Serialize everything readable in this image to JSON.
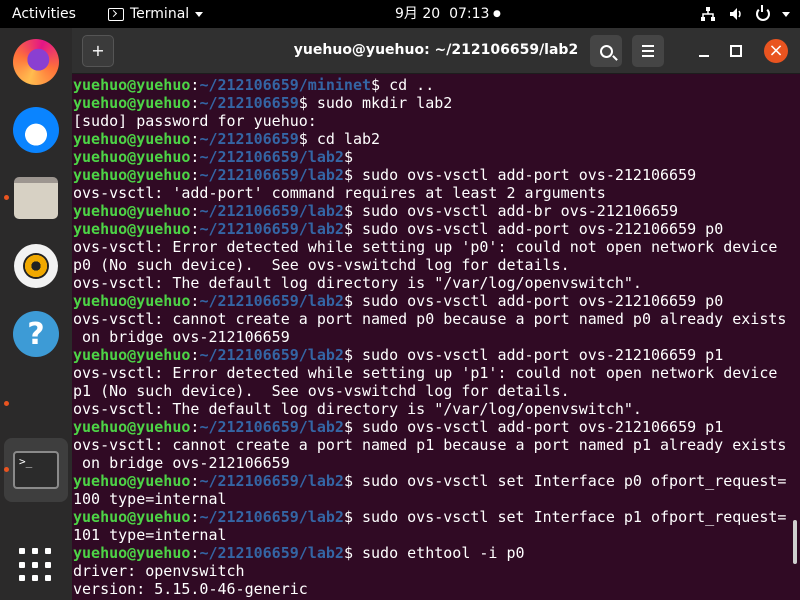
{
  "topbar": {
    "activities": "Activities",
    "app_name": "Terminal",
    "date": "9月 20",
    "time": "07:13",
    "dot": "●"
  },
  "dock": {
    "items": [
      {
        "name": "firefox-icon",
        "label": "Firefox"
      },
      {
        "name": "thunderbird-icon",
        "label": "Thunderbird"
      },
      {
        "name": "files-icon",
        "label": "Files"
      },
      {
        "name": "rhythmbox-icon",
        "label": "Rhythmbox"
      },
      {
        "name": "help-icon",
        "label": "Help",
        "glyph": "?"
      },
      {
        "name": "terminal-icon",
        "label": "Terminal",
        "glyph": ">_"
      },
      {
        "name": "show-applications-icon",
        "label": "Show Applications"
      }
    ]
  },
  "window": {
    "title": "yuehuo@yuehuo: ~/212106659/lab2"
  },
  "terminal": {
    "lines": [
      {
        "user": "yuehuo@yuehuo",
        "path": "~/212106659/mininet",
        "cmd": " cd .."
      },
      {
        "user": "yuehuo@yuehuo",
        "path": "~/212106659",
        "cmd": " sudo mkdir lab2"
      },
      {
        "text": "[sudo] password for yuehuo:"
      },
      {
        "user": "yuehuo@yuehuo",
        "path": "~/212106659",
        "cmd": " cd lab2"
      },
      {
        "user": "yuehuo@yuehuo",
        "path": "~/212106659/lab2",
        "cmd": ""
      },
      {
        "user": "yuehuo@yuehuo",
        "path": "~/212106659/lab2",
        "cmd": " sudo ovs-vsctl add-port ovs-212106659"
      },
      {
        "text": "ovs-vsctl: 'add-port' command requires at least 2 arguments"
      },
      {
        "user": "yuehuo@yuehuo",
        "path": "~/212106659/lab2",
        "cmd": " sudo ovs-vsctl add-br ovs-212106659"
      },
      {
        "user": "yuehuo@yuehuo",
        "path": "~/212106659/lab2",
        "cmd": " sudo ovs-vsctl add-port ovs-212106659 p0"
      },
      {
        "text": "ovs-vsctl: Error detected while setting up 'p0': could not open network device"
      },
      {
        "text": "p0 (No such device).  See ovs-vswitchd log for details."
      },
      {
        "text": "ovs-vsctl: The default log directory is \"/var/log/openvswitch\"."
      },
      {
        "user": "yuehuo@yuehuo",
        "path": "~/212106659/lab2",
        "cmd": " sudo ovs-vsctl add-port ovs-212106659 p0"
      },
      {
        "text": "ovs-vsctl: cannot create a port named p0 because a port named p0 already exists"
      },
      {
        "text": " on bridge ovs-212106659"
      },
      {
        "user": "yuehuo@yuehuo",
        "path": "~/212106659/lab2",
        "cmd": " sudo ovs-vsctl add-port ovs-212106659 p1"
      },
      {
        "text": "ovs-vsctl: Error detected while setting up 'p1': could not open network device"
      },
      {
        "text": "p1 (No such device).  See ovs-vswitchd log for details."
      },
      {
        "text": "ovs-vsctl: The default log directory is \"/var/log/openvswitch\"."
      },
      {
        "user": "yuehuo@yuehuo",
        "path": "~/212106659/lab2",
        "cmd": " sudo ovs-vsctl add-port ovs-212106659 p1"
      },
      {
        "text": "ovs-vsctl: cannot create a port named p1 because a port named p1 already exists"
      },
      {
        "text": " on bridge ovs-212106659"
      },
      {
        "user": "yuehuo@yuehuo",
        "path": "~/212106659/lab2",
        "cmd": " sudo ovs-vsctl set Interface p0 ofport_request="
      },
      {
        "text": "100 type=internal"
      },
      {
        "user": "yuehuo@yuehuo",
        "path": "~/212106659/lab2",
        "cmd": " sudo ovs-vsctl set Interface p1 ofport_request="
      },
      {
        "text": "101 type=internal"
      },
      {
        "user": "yuehuo@yuehuo",
        "path": "~/212106659/lab2",
        "cmd": " sudo ethtool -i p0"
      },
      {
        "text": "driver: openvswitch"
      },
      {
        "text": "version: 5.15.0-46-generic"
      }
    ]
  }
}
